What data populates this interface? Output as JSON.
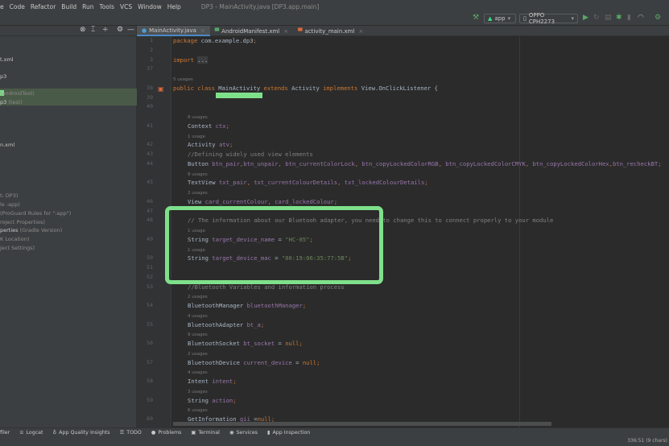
{
  "menu": {
    "items": [
      "e",
      "Code",
      "Refactor",
      "Build",
      "Run",
      "Tools",
      "VCS",
      "Window",
      "Help"
    ],
    "title": "DP3 - MainActivity.java [DP3.app.main]"
  },
  "toolbar": {
    "config": "app",
    "device": "OPPO CPH2273"
  },
  "colors": {
    "accent": "#7fe08a",
    "keyword": "#cc7832",
    "field": "#9876aa",
    "string": "#6a8759",
    "comment": "#808080"
  },
  "sidebar": {
    "items": [
      {
        "text": "t.xml",
        "dim": ""
      },
      {
        "text": "p3",
        "dim": ""
      },
      {
        "text": "",
        "dim": "(androidTest)"
      },
      {
        "text": "p3",
        "dim": "(test)"
      },
      {
        "text": "n.xml",
        "dim": ""
      },
      {
        "text": "",
        "dim": "t: DP3)"
      },
      {
        "text": "",
        "dim": "le :app)"
      },
      {
        "text": "",
        "dim": "(ProGuard Rules for \":app\")"
      },
      {
        "text": "",
        "dim": "roject Properties)"
      },
      {
        "text": "perties",
        "dim": "(Gradle Version)"
      },
      {
        "text": "",
        "dim": "K Location)"
      },
      {
        "text": "",
        "dim": "ject Settings)"
      }
    ]
  },
  "tabs": [
    {
      "label": "MainActivity.java",
      "icon": "C"
    },
    {
      "label": "AndroidManifest.xml",
      "icon": "M"
    },
    {
      "label": "activity_main.xml",
      "icon": "L"
    }
  ],
  "code": [
    {
      "ln": "1",
      "tok": [
        [
          "k",
          "package "
        ],
        [
          "t",
          "com.example.dp3"
        ],
        [
          "k",
          ";"
        ]
      ]
    },
    {
      "ln": "2",
      "tok": []
    },
    {
      "ln": "3",
      "tok": [
        [
          "k",
          "import "
        ],
        [
          "fold",
          "..."
        ]
      ]
    },
    {
      "ln": "37",
      "tok": []
    },
    {
      "usage": "5 usages"
    },
    {
      "ln": "38",
      "tok": [
        [
          "k",
          "public class "
        ],
        [
          "t",
          "MainActivity "
        ],
        [
          "k",
          "extends "
        ],
        [
          "t",
          "Activity "
        ],
        [
          "k",
          "implements "
        ],
        [
          "t",
          "View.OnClickListener {"
        ]
      ]
    },
    {
      "ln": "39",
      "tok": []
    },
    {
      "ln": "40",
      "tok": []
    },
    {
      "usage": "8 usages",
      "in": 1
    },
    {
      "ln": "41",
      "in": 1,
      "tok": [
        [
          "t",
          "Context "
        ],
        [
          "f",
          "ctx"
        ],
        [
          "k",
          ";"
        ]
      ]
    },
    {
      "usage": "1 usage",
      "in": 1
    },
    {
      "ln": "42",
      "in": 1,
      "tok": [
        [
          "t",
          "Activity "
        ],
        [
          "f",
          "atv"
        ],
        [
          "k",
          ";"
        ]
      ]
    },
    {
      "ln": "43",
      "in": 1,
      "tok": [
        [
          "c",
          "//Defining widely used view elements"
        ]
      ]
    },
    {
      "ln": "44",
      "in": 1,
      "tok": [
        [
          "t",
          "Button "
        ],
        [
          "f",
          "btn_pair"
        ],
        [
          "k",
          ","
        ],
        [
          "f",
          "btn_unpair"
        ],
        [
          "k",
          ", "
        ],
        [
          "f",
          "btn_currentColorLock"
        ],
        [
          "k",
          ", "
        ],
        [
          "f",
          "btn_copyLockedColorRGB"
        ],
        [
          "k",
          ", "
        ],
        [
          "f",
          "btn_copyLockedColorCMYK"
        ],
        [
          "k",
          ", "
        ],
        [
          "f",
          "btn_copyLockedColorHex"
        ],
        [
          "k",
          ","
        ],
        [
          "f",
          "btn_recheckBT"
        ],
        [
          "k",
          ";"
        ]
      ]
    },
    {
      "usage": "8 usages",
      "in": 1
    },
    {
      "ln": "45",
      "in": 1,
      "tok": [
        [
          "t",
          "TextView "
        ],
        [
          "f",
          "txt_pair"
        ],
        [
          "k",
          ", "
        ],
        [
          "f",
          "txt_currentColourDetails"
        ],
        [
          "k",
          ", "
        ],
        [
          "f",
          "txt_lockedColourDetails"
        ],
        [
          "k",
          ";"
        ]
      ]
    },
    {
      "usage": "2 usages",
      "in": 1
    },
    {
      "ln": "46",
      "in": 1,
      "tok": [
        [
          "t",
          "View "
        ],
        [
          "f",
          "card_currentColour"
        ],
        [
          "k",
          ", "
        ],
        [
          "f",
          "card_lockedColour"
        ],
        [
          "k",
          ";"
        ]
      ]
    },
    {
      "ln": "47",
      "tok": []
    },
    {
      "ln": "48",
      "in": 1,
      "tok": [
        [
          "c",
          "// The information about our Bluetooh adapter, you need to change this to connect properly to your module"
        ]
      ]
    },
    {
      "usage": "1 usage",
      "in": 1
    },
    {
      "ln": "49",
      "in": 1,
      "tok": [
        [
          "t",
          "String "
        ],
        [
          "f",
          "target_device_name"
        ],
        [
          "t",
          " = "
        ],
        [
          "s",
          "\"HC-05\""
        ],
        [
          "k",
          ";"
        ]
      ]
    },
    {
      "usage": "1 usage",
      "in": 1
    },
    {
      "ln": "50",
      "in": 1,
      "tok": [
        [
          "t",
          "String "
        ],
        [
          "f",
          "target_device_mac"
        ],
        [
          "t",
          " = "
        ],
        [
          "s",
          "\"00:19:06:35:77:5B\""
        ],
        [
          "k",
          ";"
        ]
      ]
    },
    {
      "ln": "51",
      "tok": []
    },
    {
      "ln": "52",
      "tok": []
    },
    {
      "ln": "53",
      "in": 1,
      "tok": [
        [
          "c",
          "//Bluetooth Variables and information process"
        ]
      ]
    },
    {
      "usage": "2 usages",
      "in": 1
    },
    {
      "ln": "54",
      "in": 1,
      "tok": [
        [
          "t",
          "BluetoothManager "
        ],
        [
          "f",
          "bluetoothManager"
        ],
        [
          "k",
          ";"
        ]
      ]
    },
    {
      "usage": "4 usages",
      "in": 1
    },
    {
      "ln": "55",
      "in": 1,
      "tok": [
        [
          "t",
          "BluetoothAdapter "
        ],
        [
          "f",
          "bt_a"
        ],
        [
          "k",
          ";"
        ]
      ]
    },
    {
      "usage": "9 usages",
      "in": 1
    },
    {
      "ln": "56",
      "in": 1,
      "tok": [
        [
          "t",
          "BluetoothSocket "
        ],
        [
          "f",
          "bt_socket"
        ],
        [
          "t",
          " = "
        ],
        [
          "k",
          "null;"
        ]
      ]
    },
    {
      "usage": "2 usages",
      "in": 1
    },
    {
      "ln": "57",
      "in": 1,
      "tok": [
        [
          "t",
          "BluetoothDevice "
        ],
        [
          "f",
          "current_device"
        ],
        [
          "t",
          " = "
        ],
        [
          "k",
          "null;"
        ]
      ]
    },
    {
      "usage": "4 usages",
      "in": 1
    },
    {
      "ln": "58",
      "in": 1,
      "tok": [
        [
          "t",
          "Intent "
        ],
        [
          "f",
          "intent"
        ],
        [
          "k",
          ";"
        ]
      ]
    },
    {
      "usage": "3 usages",
      "in": 1
    },
    {
      "ln": "59",
      "in": 1,
      "tok": [
        [
          "t",
          "String "
        ],
        [
          "f",
          "action"
        ],
        [
          "k",
          ";"
        ]
      ]
    },
    {
      "usage": "6 usages",
      "in": 1
    },
    {
      "ln": "60",
      "in": 1,
      "tok": [
        [
          "t",
          "GetInformation "
        ],
        [
          "f",
          "gii"
        ],
        [
          "t",
          " ="
        ],
        [
          "k",
          "null;"
        ]
      ]
    }
  ],
  "bottom": {
    "tools": [
      "filer",
      "Logcat",
      "App Quality Insights",
      "TODO",
      "Problems",
      "Terminal",
      "Services",
      "App Inspection"
    ],
    "status": "336:51 (9 chars)"
  }
}
